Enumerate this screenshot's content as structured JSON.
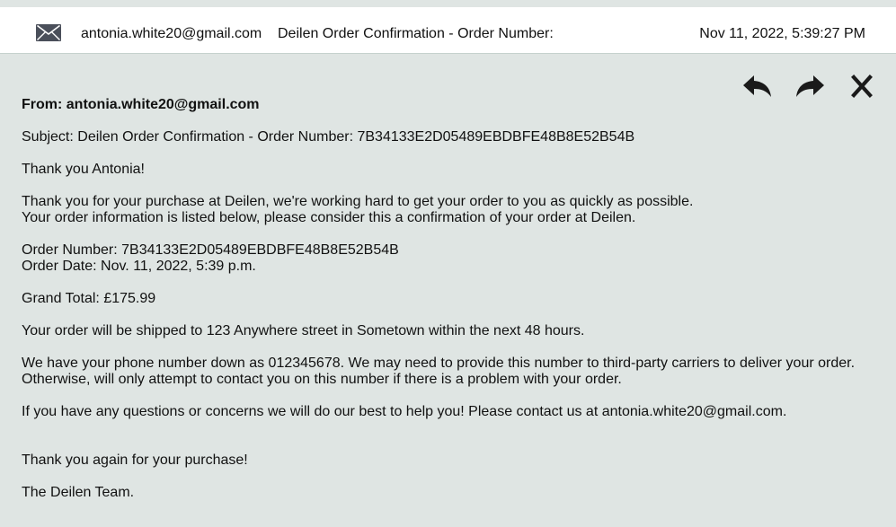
{
  "header": {
    "mail_icon": "envelope-icon",
    "sender": "antonia.white20@gmail.com",
    "subject": "Deilen Order Confirmation - Order Number:",
    "date": "Nov 11, 2022, 5:39:27 PM"
  },
  "actions": {
    "reply_icon": "reply-arrow-icon",
    "forward_icon": "forward-arrow-icon",
    "close_icon": "close-x-icon"
  },
  "email": {
    "from": "From: antonia.white20@gmail.com",
    "subject": "Subject: Deilen Order Confirmation - Order Number: 7B34133E2D05489EBDBFE48B8E52B54B",
    "greeting": "Thank you Antonia!",
    "intro_line1": "Thank you for your purchase at Deilen, we're working hard to get your order to you as quickly as possible.",
    "intro_line2": "Your order information is listed below, please consider this a confirmation of your order at Deilen.",
    "order_number": "Order Number: 7B34133E2D05489EBDBFE48B8E52B54B",
    "order_date": "Order Date: Nov. 11, 2022, 5:39 p.m.",
    "grand_total": "Grand Total: £175.99",
    "shipping": "Your order will be shipped to 123 Anywhere street in Sometown within the next 48 hours.",
    "phone_line1": "We have your phone number down as 012345678. We may need to provide this number to third-party carriers to deliver your order.",
    "phone_line2": "Otherwise, will only attempt to contact you on this number if there is a problem with your order.",
    "questions": "If you have any questions or concerns we will do our best to help you! Please contact us at antonia.white20@gmail.com.",
    "thanks_again": "Thank you again for your purchase!",
    "signature": "The Deilen Team."
  }
}
